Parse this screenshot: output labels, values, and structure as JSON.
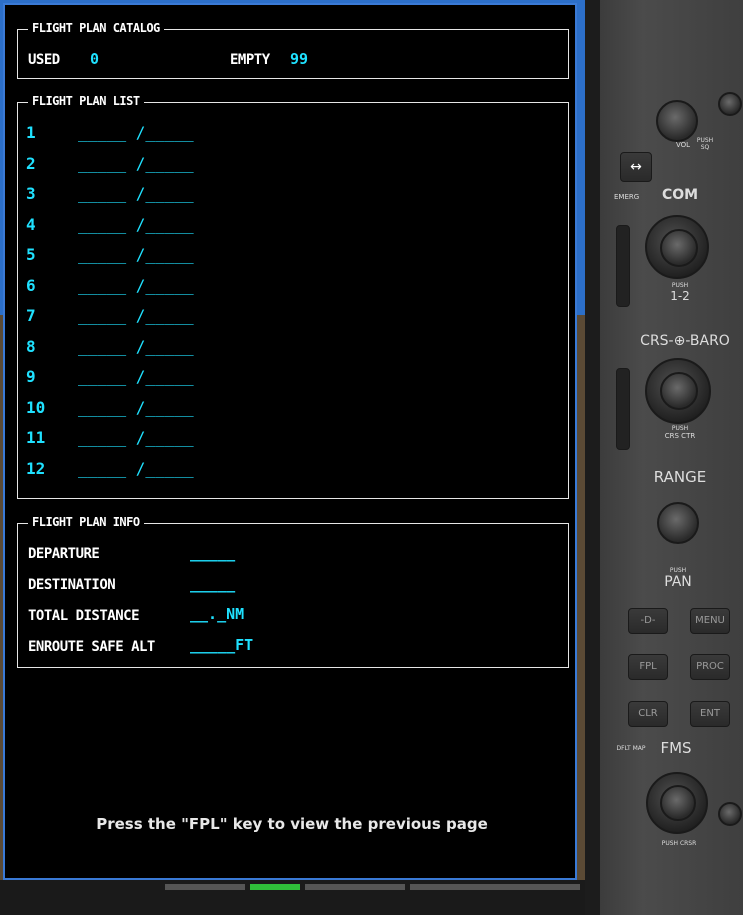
{
  "catalog": {
    "title": "FLIGHT PLAN CATALOG",
    "used_label": "USED",
    "used_value": "0",
    "empty_label": "EMPTY",
    "empty_value": "99"
  },
  "list": {
    "title": "FLIGHT PLAN LIST",
    "rows": [
      {
        "num": "1",
        "entry": "_____ /_____"
      },
      {
        "num": "2",
        "entry": "_____ /_____"
      },
      {
        "num": "3",
        "entry": "_____ /_____"
      },
      {
        "num": "4",
        "entry": "_____ /_____"
      },
      {
        "num": "5",
        "entry": "_____ /_____"
      },
      {
        "num": "6",
        "entry": "_____ /_____"
      },
      {
        "num": "7",
        "entry": "_____ /_____"
      },
      {
        "num": "8",
        "entry": "_____ /_____"
      },
      {
        "num": "9",
        "entry": "_____ /_____"
      },
      {
        "num": "10",
        "entry": "_____ /_____"
      },
      {
        "num": "11",
        "entry": "_____ /_____"
      },
      {
        "num": "12",
        "entry": "_____ /_____"
      }
    ]
  },
  "info": {
    "title": "FLIGHT PLAN INFO",
    "departure_label": "DEPARTURE",
    "departure_value": "_____",
    "destination_label": "DESTINATION",
    "destination_value": "_____",
    "total_distance_label": "TOTAL DISTANCE",
    "total_distance_value": "__._NM",
    "enroute_safe_alt_label": "ENROUTE SAFE ALT",
    "enroute_safe_alt_value": "_____FT"
  },
  "footer": {
    "message": "Press the \"FPL\" key to view the previous page"
  },
  "bezel": {
    "vol_label": "VOL",
    "vol_push": "PUSH SQ",
    "swap_symbol": "↔",
    "emerg_label": "EMERG",
    "com_label": "COM",
    "com_push_1": "PUSH",
    "com_push_2": "1-2",
    "crs_baro_label": "CRS-⊕-BARO",
    "crs_push_1": "PUSH",
    "crs_push_2": "CRS CTR",
    "range_label": "RANGE",
    "pan_push": "PUSH",
    "pan_label": "PAN",
    "direct_to": "-D-",
    "menu": "MENU",
    "fpl": "FPL",
    "proc": "PROC",
    "clr": "CLR",
    "ent": "ENT",
    "dflt_map": "DFLT MAP",
    "fms_label": "FMS",
    "push_crsr": "PUSH CRSR"
  },
  "colors": {
    "cyan": "#1fe1ff",
    "frame_blue": "#3a7ad6",
    "white": "#ffffff"
  }
}
